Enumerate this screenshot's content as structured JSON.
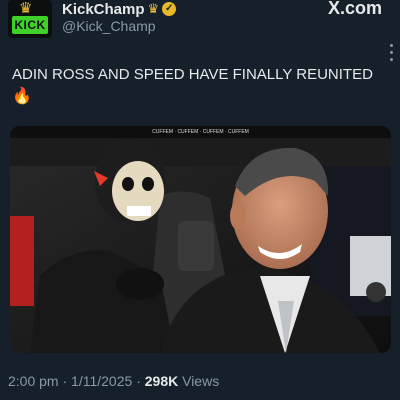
{
  "header": {
    "avatar_label": "KICK",
    "display_name": "KickChamp",
    "handle": "@Kick_Champ",
    "watermark": "X.com"
  },
  "tweet": {
    "text": "ADIN ROSS AND SPEED HAVE FINALLY REUNITED",
    "emoji": "🔥",
    "media_caption": "CUFFEM · CUFFEM · CUFFEM · CUFFEM",
    "time": "2:00 pm",
    "date": "1/11/2025",
    "views_count": "298K",
    "views_label": "Views"
  },
  "colors": {
    "background": "#15202b",
    "verified_badge": "#e8b829",
    "kick_green": "#3fd12a",
    "secondary_text": "#8b98a5"
  }
}
